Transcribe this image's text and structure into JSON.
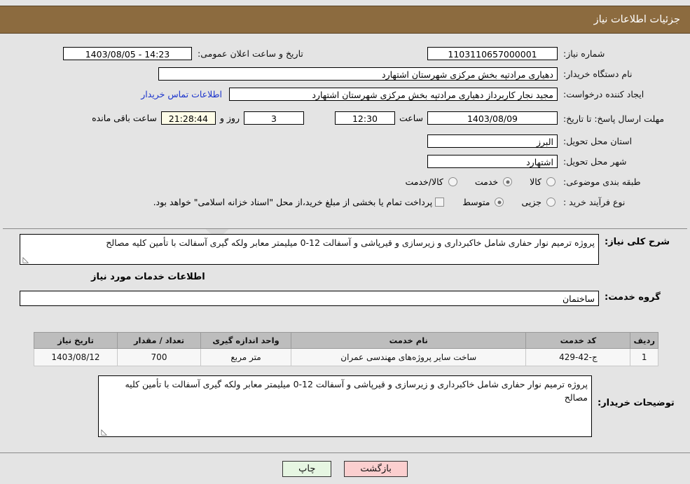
{
  "header": {
    "title": "جزئیات اطلاعات نیاز"
  },
  "watermark": {
    "text": "AriaTender.net"
  },
  "info": {
    "need_number_label": "شماره نیاز:",
    "need_number_value": "1103110657000001",
    "announce_datetime_label": "تاریخ و ساعت اعلان عمومی:",
    "announce_datetime_value": "14:23 - 1403/08/05",
    "buyer_org_label": "نام دستگاه خریدار:",
    "buyer_org_value": "دهیاری مرادتپه بخش مرکزی شهرستان اشتهارد",
    "creator_label": "ایجاد کننده درخواست:",
    "creator_value": "مجید نجار کاربرداز دهیاری مرادتپه بخش مرکزی شهرستان اشتهارد",
    "contact_link": "اطلاعات تماس خریدار",
    "deadline_label": "مهلت ارسال پاسخ: تا تاریخ:",
    "deadline_date": "1403/08/09",
    "hour_label": "ساعت",
    "deadline_time": "12:30",
    "days_remaining": "3",
    "days_and_label": "روز و",
    "time_remaining": "21:28:44",
    "remaining_suffix_label": "ساعت باقی مانده",
    "province_label": "استان محل تحویل:",
    "province_value": "البرز",
    "city_label": "شهر محل تحویل:",
    "city_value": "اشتهارد",
    "category_label": "طبقه بندی موضوعی:",
    "category_options": [
      "کالا",
      "خدمت",
      "کالا/خدمت"
    ],
    "category_selected_index": 1,
    "purchase_type_label": "نوع فرآیند خرید :",
    "purchase_type_options": [
      "جزیی",
      "متوسط"
    ],
    "purchase_type_selected_index": 1,
    "treasury_note": "پرداخت تمام یا بخشی از مبلغ خرید،از محل \"اسناد خزانه اسلامی\" خواهد بود.",
    "treasury_checked": false
  },
  "description": {
    "label": "شرح کلی نیاز:",
    "value": "پروژه ترمیم نوار حفاری شامل خاکبرداری و زیرسازی و قیرپاشی و آسفالت 12-0 میلیمتر معابر ولکه گیری آسفالت با تأمین کلیه مصالح"
  },
  "services_section": {
    "title": "اطلاعات خدمات مورد نیاز",
    "group_label": "گروه خدمت:",
    "group_value": "ساختمان"
  },
  "table": {
    "columns": [
      "ردیف",
      "کد خدمت",
      "نام خدمت",
      "واحد اندازه گیری",
      "تعداد / مقدار",
      "تاریخ نیاز"
    ],
    "rows": [
      {
        "index": "1",
        "code": "ج-42-429",
        "name": "ساخت سایر پروژه‌های مهندسی عمران",
        "unit": "متر مربع",
        "quantity": "700",
        "date": "1403/08/12"
      }
    ]
  },
  "buyer_notes": {
    "label": "توضیحات خریدار:",
    "value": "پروژه ترمیم نوار حفاری شامل خاکبرداری و زیرسازی و قیرپاشی و آسفالت 12-0 میلیمتر معابر ولکه گیری آسفالت با تأمین کلیه مصالح"
  },
  "footer": {
    "back_label": "بازگشت",
    "print_label": "چاپ"
  },
  "colors": {
    "header_bg": "#8c6b3f",
    "page_bg": "#e4e4e4",
    "link": "#1a33cc",
    "back_btn": "#fbcfcf",
    "print_btn": "#e6f6e2",
    "table_header": "#bdbdbd"
  }
}
